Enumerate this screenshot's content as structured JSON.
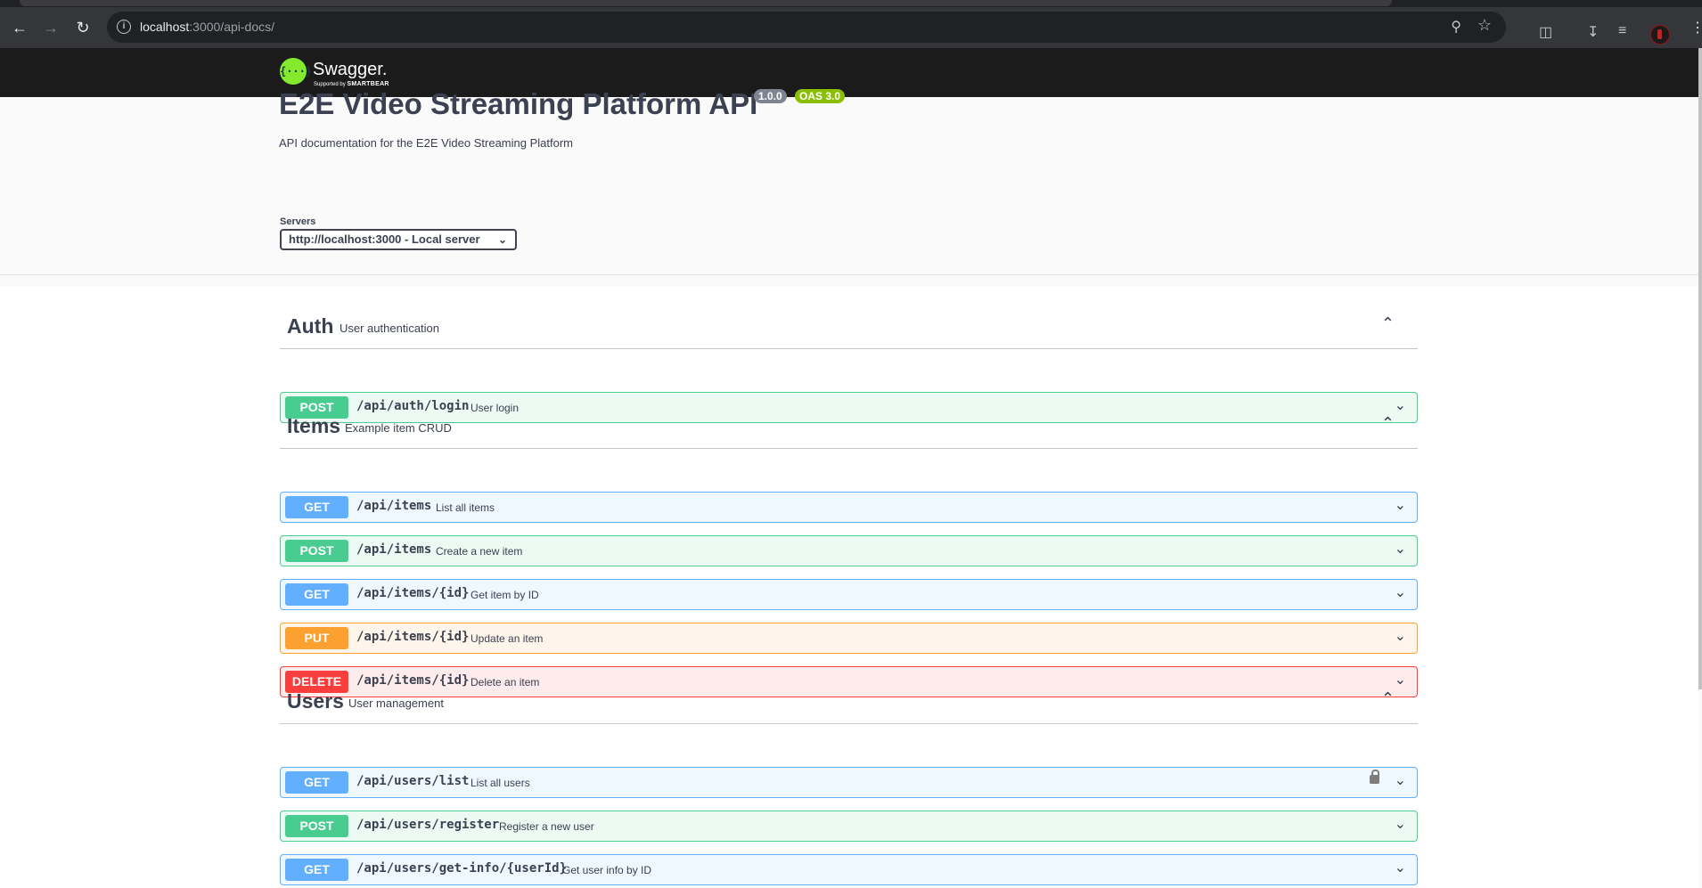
{
  "browser": {
    "url_host": "localhost",
    "url_path": ":3000/api-docs/",
    "icons": [
      "back-arrow-icon",
      "forward-arrow-icon",
      "reload-icon",
      "site-info-icon",
      "zoom-icon",
      "bookmark-star-icon",
      "extensions-icon",
      "download-icon",
      "media-control-icon",
      "profile-avatar",
      "menu-icon"
    ]
  },
  "swagger": {
    "logo_badge": "{···}",
    "logo_name": "Swagger.",
    "logo_sub_prefix": "Supported by ",
    "logo_sub_brand": "SMARTBEAR",
    "colors": {
      "topbar": "#1b1b1b",
      "brand_green": "#85ea2d"
    }
  },
  "info": {
    "title": "E2E Video Streaming Platform API",
    "version": "1.0.0",
    "oas": "OAS 3.0",
    "description": "API documentation for the E2E Video Streaming Platform"
  },
  "servers": {
    "label": "Servers",
    "selected": "http://localhost:3000 - Local server"
  },
  "tags": [
    {
      "name": "Auth",
      "description": "User authentication",
      "operations": [
        {
          "method": "POST",
          "path": "/api/auth/login",
          "summary": "User login"
        }
      ]
    },
    {
      "name": "Items",
      "description": "Example item CRUD",
      "operations": [
        {
          "method": "GET",
          "path": "/api/items",
          "summary": "List all items"
        },
        {
          "method": "POST",
          "path": "/api/items",
          "summary": "Create a new item"
        },
        {
          "method": "GET",
          "path": "/api/items/{id}",
          "summary": "Get item by ID"
        },
        {
          "method": "PUT",
          "path": "/api/items/{id}",
          "summary": "Update an item"
        },
        {
          "method": "DELETE",
          "path": "/api/items/{id}",
          "summary": "Delete an item"
        }
      ]
    },
    {
      "name": "Users",
      "description": "User management",
      "operations": [
        {
          "method": "GET",
          "path": "/api/users/list",
          "summary": "List all users",
          "locked": true
        },
        {
          "method": "POST",
          "path": "/api/users/register",
          "summary": "Register a new user"
        },
        {
          "method": "GET",
          "path": "/api/users/get-info/{userId}",
          "summary": "Get user info by ID"
        }
      ]
    }
  ],
  "method_colors": {
    "GET": "#61affe",
    "POST": "#49cc90",
    "PUT": "#fca130",
    "DELETE": "#f93e3e"
  }
}
